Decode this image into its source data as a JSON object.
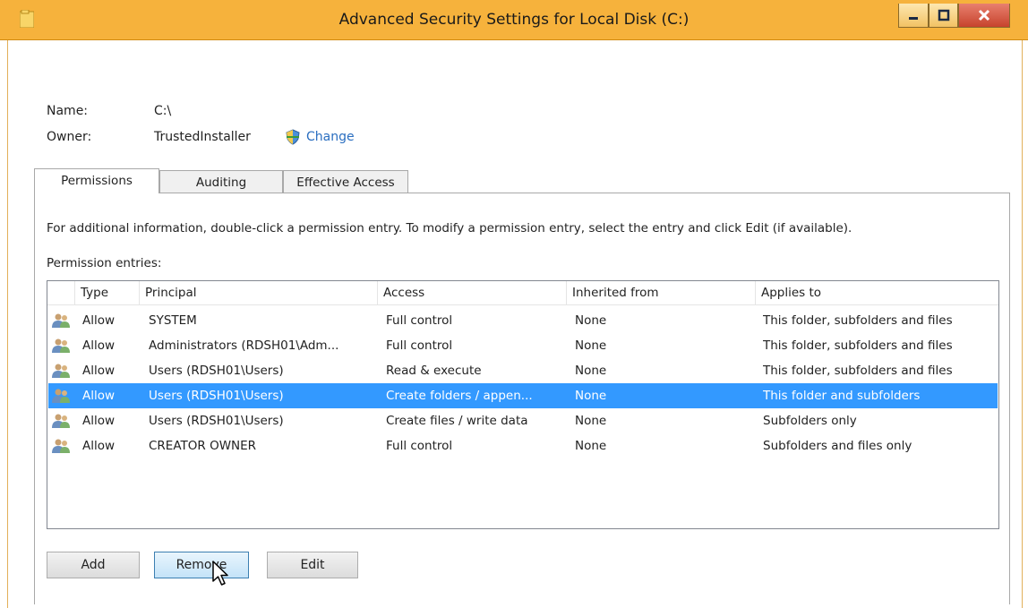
{
  "window": {
    "title": "Advanced Security Settings for Local Disk (C:)",
    "controls": {
      "minimize": "–",
      "maximize": "□",
      "close": "x"
    }
  },
  "info": {
    "name_label": "Name:",
    "name_value": "C:\\",
    "owner_label": "Owner:",
    "owner_value": "TrustedInstaller",
    "change_link": "Change"
  },
  "tabs": [
    {
      "label": "Permissions",
      "active": true
    },
    {
      "label": "Auditing",
      "active": false
    },
    {
      "label": "Effective Access",
      "active": false
    }
  ],
  "instructions": "For additional information, double-click a permission entry. To modify a permission entry, select the entry and click Edit (if available).",
  "entries_label": "Permission entries:",
  "table": {
    "columns": [
      "Type",
      "Principal",
      "Access",
      "Inherited from",
      "Applies to"
    ],
    "rows": [
      {
        "type": "Allow",
        "principal": "SYSTEM",
        "access": "Full control",
        "inherited": "None",
        "applies": "This folder, subfolders and files",
        "selected": false
      },
      {
        "type": "Allow",
        "principal": "Administrators (RDSH01\\Adm...",
        "access": "Full control",
        "inherited": "None",
        "applies": "This folder, subfolders and files",
        "selected": false
      },
      {
        "type": "Allow",
        "principal": "Users (RDSH01\\Users)",
        "access": "Read & execute",
        "inherited": "None",
        "applies": "This folder, subfolders and files",
        "selected": false
      },
      {
        "type": "Allow",
        "principal": "Users (RDSH01\\Users)",
        "access": "Create folders / appen...",
        "inherited": "None",
        "applies": "This folder and subfolders",
        "selected": true
      },
      {
        "type": "Allow",
        "principal": "Users (RDSH01\\Users)",
        "access": "Create files / write data",
        "inherited": "None",
        "applies": "Subfolders only",
        "selected": false
      },
      {
        "type": "Allow",
        "principal": "CREATOR OWNER",
        "access": "Full control",
        "inherited": "None",
        "applies": "Subfolders and files only",
        "selected": false
      }
    ]
  },
  "buttons": {
    "add": "Add",
    "remove": "Remove",
    "edit": "Edit"
  },
  "colors": {
    "titlebar": "#f6b23c",
    "selection": "#3399ff",
    "link": "#2a6ec0",
    "close": "#c7432d"
  },
  "icons": {
    "title": "folder-icon",
    "owner": "shield-icon",
    "row": "users-icon",
    "cursor": "mouse-pointer-icon"
  }
}
